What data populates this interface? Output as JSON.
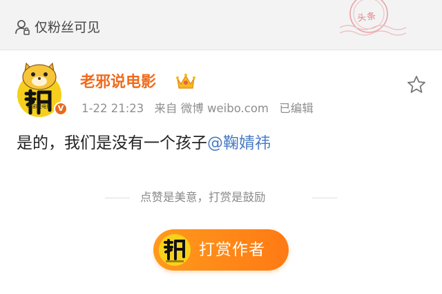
{
  "visibility": {
    "label": "仅粉丝可见",
    "icon": "user-privacy-icon"
  },
  "stamp": {
    "text": "头条",
    "icon": "postmark-stamp-icon"
  },
  "post": {
    "author": "老邪说电影",
    "avatar_brand": "老邪说电影",
    "verified_badge": "V",
    "date": "1-22 21:23",
    "source": "来自 微博 weibo.com",
    "edited": "已编辑",
    "text": "是的，我们是没有一个孩子",
    "mention": "@鞠婧祎"
  },
  "reward": {
    "prompt": "点赞是美意，打赏是鼓励",
    "button_label": "打赏作者"
  },
  "colors": {
    "username": "#ef6b1d",
    "link": "#4a7cc4",
    "reward_button": "#ff8617"
  },
  "icons": [
    "user-privacy-icon",
    "crown-icon",
    "star-icon",
    "verified-badge-icon",
    "avatar-logo-icon"
  ]
}
